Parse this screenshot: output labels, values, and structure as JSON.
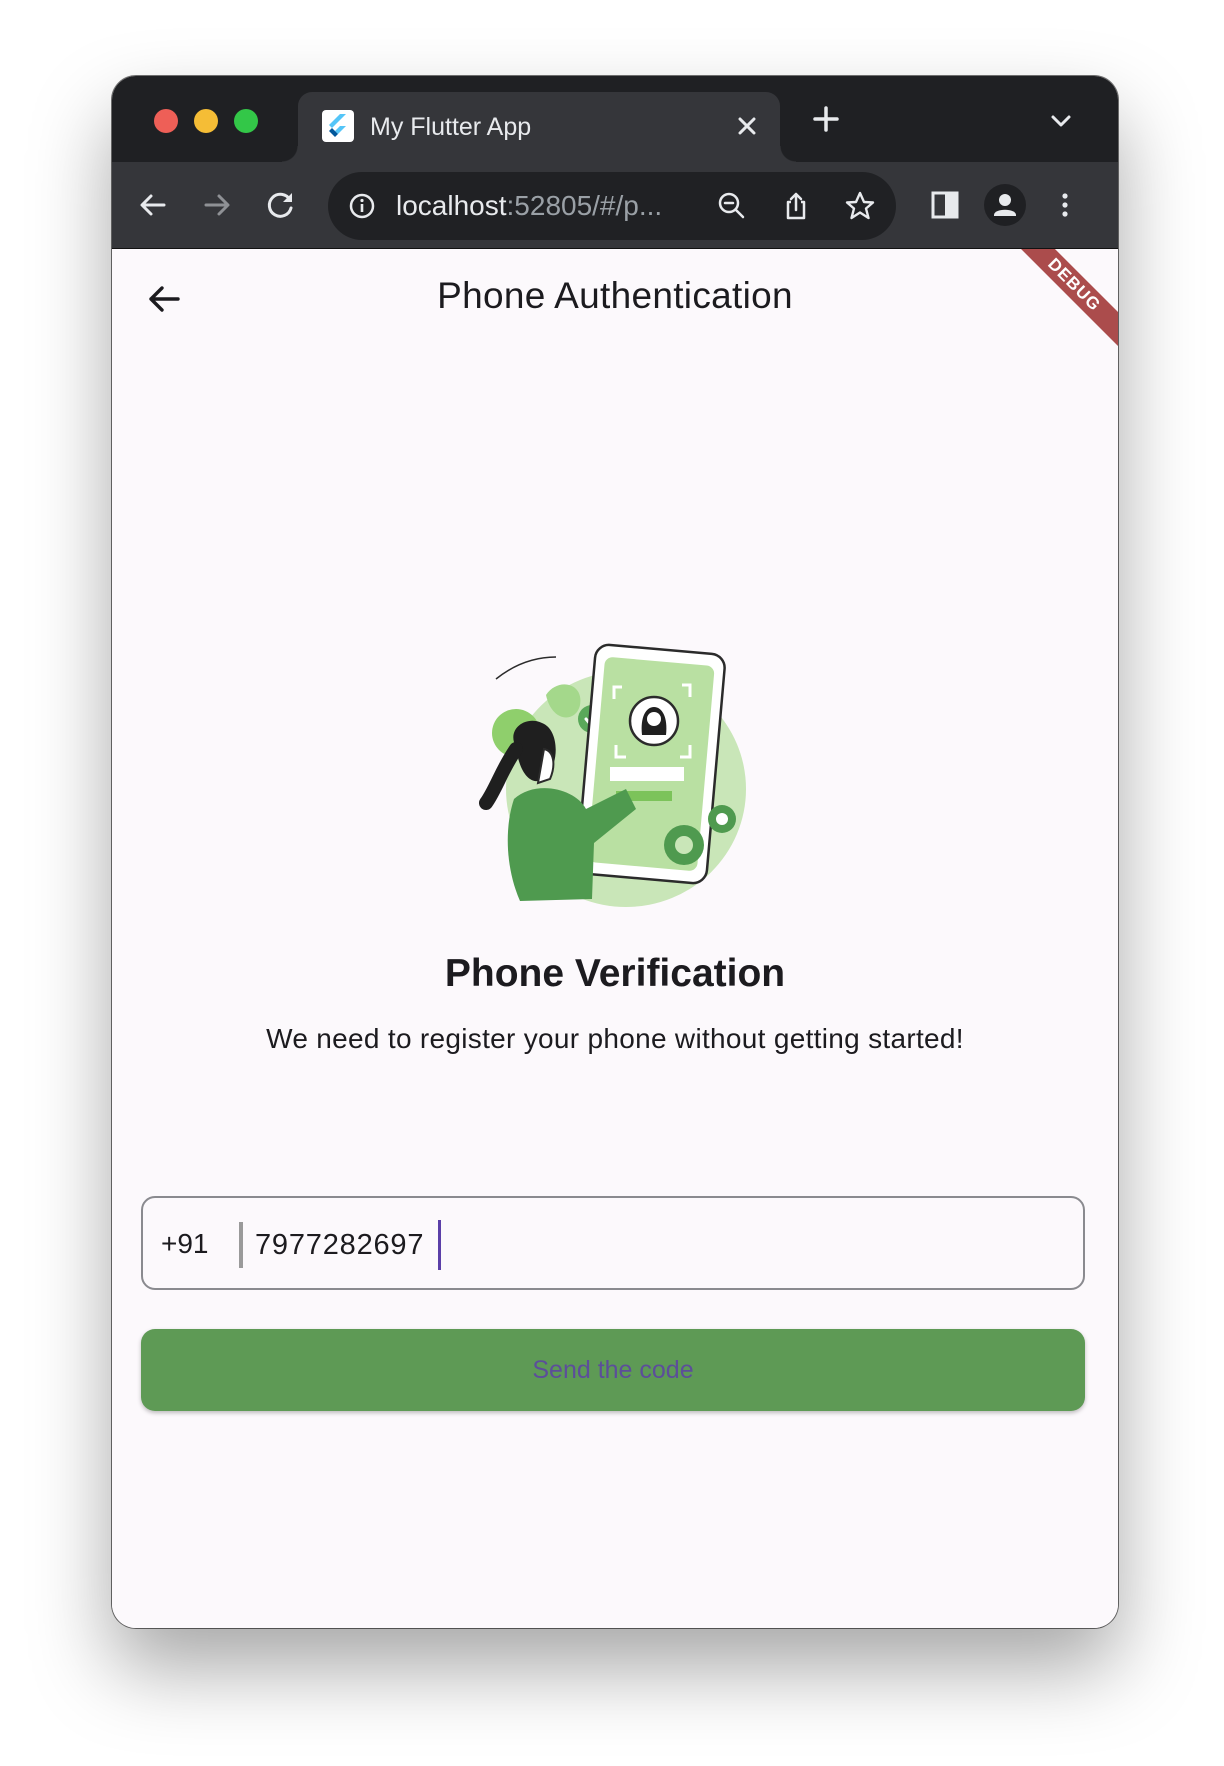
{
  "browser": {
    "tab_title": "My Flutter App",
    "url_host": "localhost",
    "url_rest": ":52805/#/p..."
  },
  "app": {
    "title": "Phone Authentication",
    "debug_banner": "DEBUG"
  },
  "content": {
    "heading": "Phone Verification",
    "description": "We need to register your phone without getting started!",
    "country_code": "+91",
    "phone_value": "7977282697",
    "send_button": "Send the code"
  },
  "colors": {
    "accent_green": "#5e9a55",
    "browser_dark": "#35363a"
  }
}
